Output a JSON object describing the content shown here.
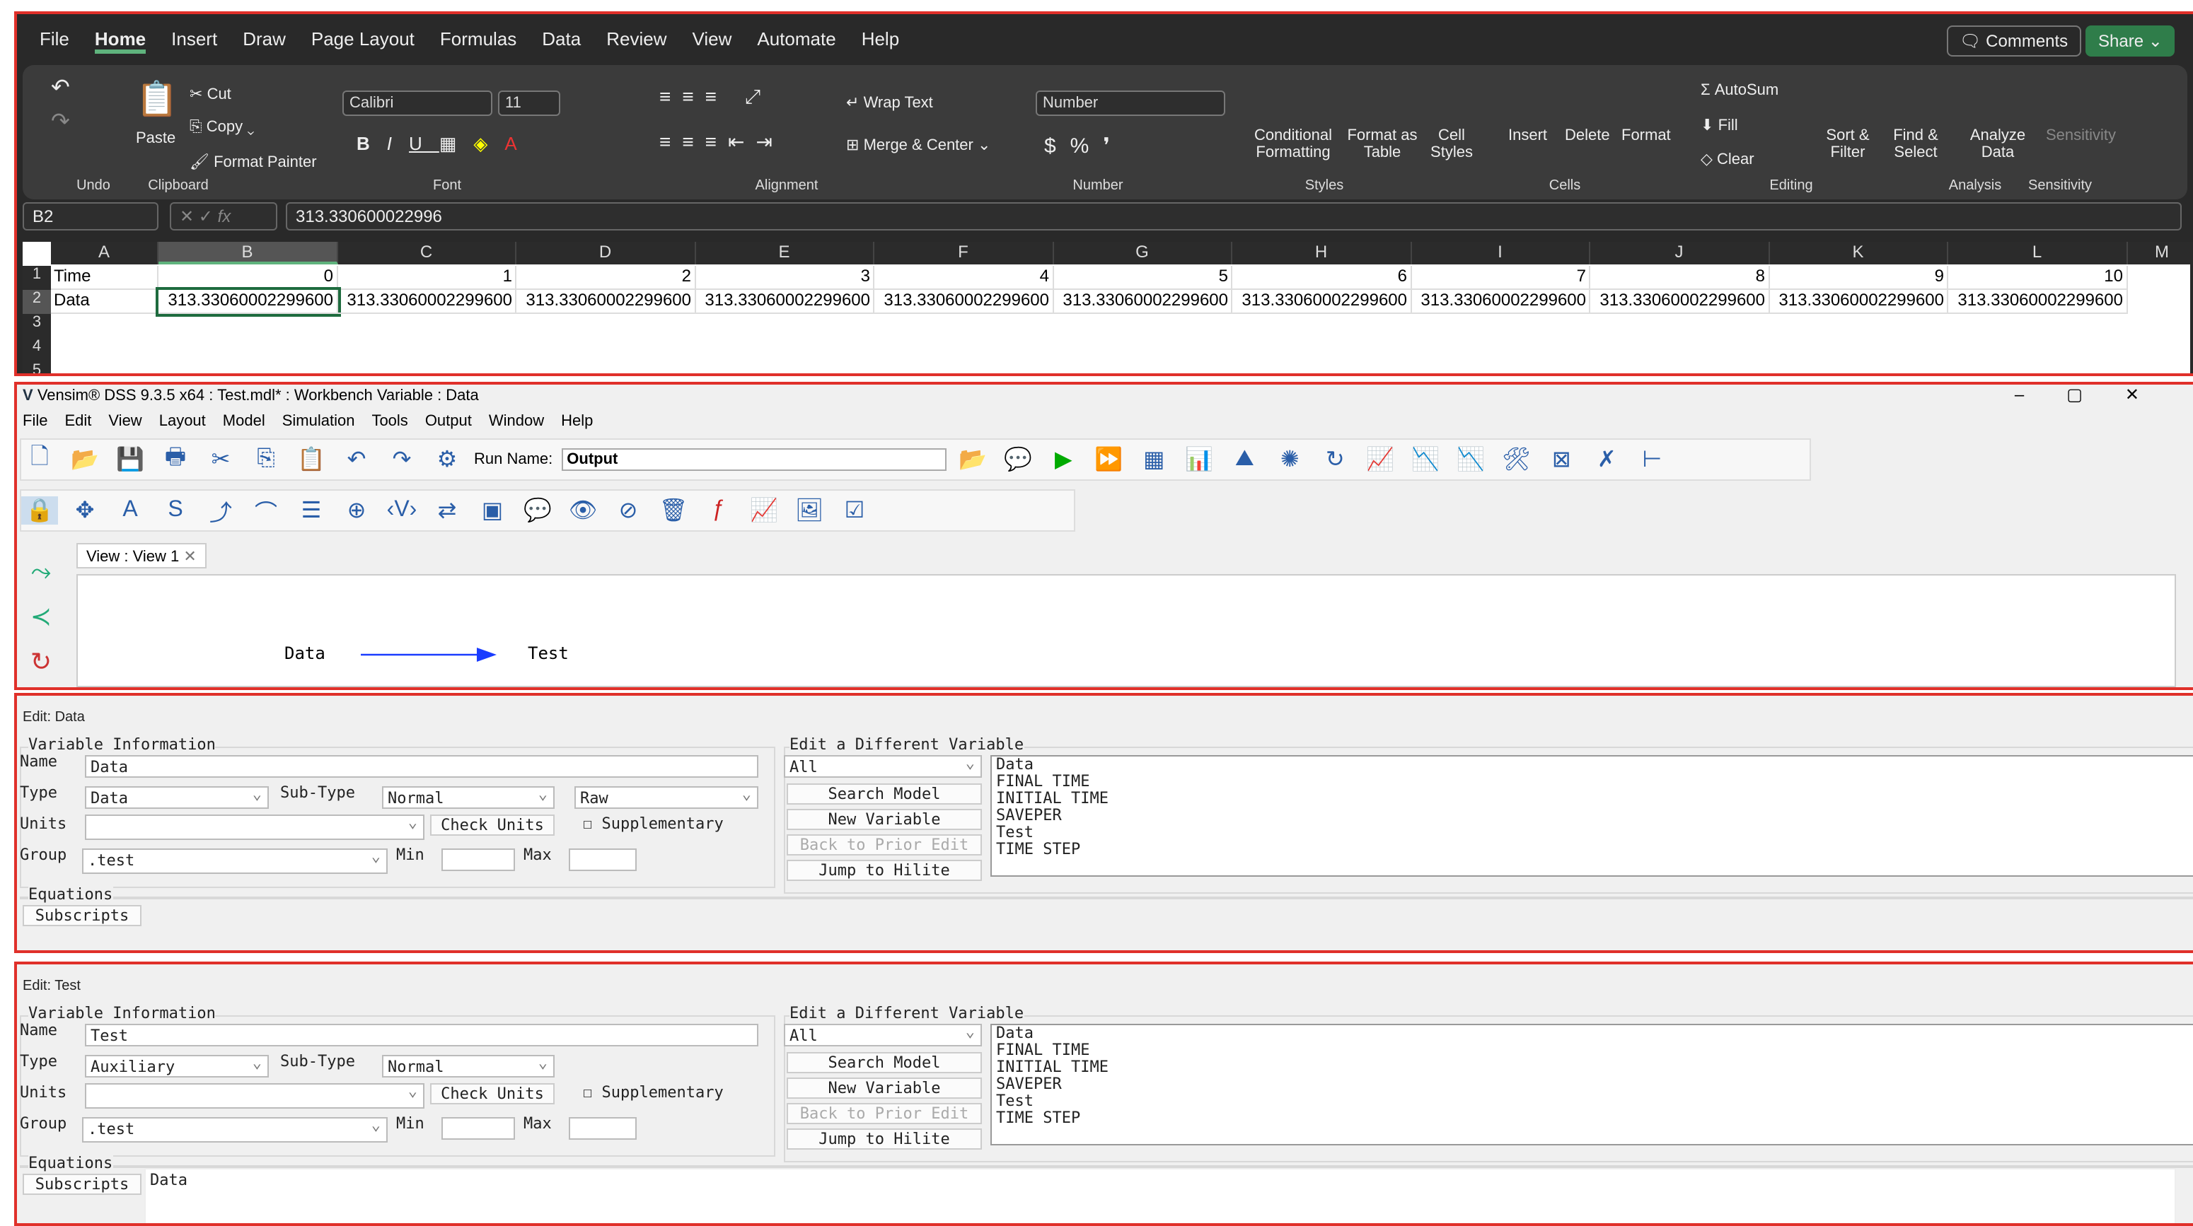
{
  "excel": {
    "tabs": [
      "File",
      "Home",
      "Insert",
      "Draw",
      "Page Layout",
      "Formulas",
      "Data",
      "Review",
      "View",
      "Automate",
      "Help"
    ],
    "active_tab": "Home",
    "comments": "Comments",
    "share": "Share",
    "clipboard": {
      "paste": "Paste",
      "cut": "Cut",
      "copy": "Copy",
      "format_painter": "Format Painter"
    },
    "font": {
      "name": "Calibri",
      "size": "11"
    },
    "alignment": {
      "wrap": "Wrap Text",
      "merge": "Merge & Center"
    },
    "number_format": "Number",
    "styles": [
      "Conditional Formatting",
      "Format as Table",
      "Cell Styles"
    ],
    "cells_btns": [
      "Insert",
      "Delete",
      "Format"
    ],
    "editing": {
      "autosum": "AutoSum",
      "fill": "Fill",
      "clear": "Clear",
      "sort": "Sort & Filter",
      "find": "Find & Select"
    },
    "analyze": "Analyze Data",
    "sensitivity": "Sensitivity",
    "groups": [
      "Undo",
      "Clipboard",
      "Font",
      "Alignment",
      "Number",
      "Styles",
      "Cells",
      "Editing",
      "Analysis",
      "Sensitivity"
    ],
    "name_box": "B2",
    "formula": "313.330600022996",
    "columns": [
      "A",
      "B",
      "C",
      "D",
      "E",
      "F",
      "G",
      "H",
      "I",
      "J",
      "K",
      "L",
      "M"
    ],
    "rows": [
      "1",
      "2",
      "3",
      "4",
      "5"
    ],
    "row1": [
      "Time",
      "0",
      "1",
      "2",
      "3",
      "4",
      "5",
      "6",
      "7",
      "8",
      "9",
      "10"
    ],
    "row2": [
      "Data",
      "313.33060002299600",
      "313.33060002299600",
      "313.33060002299600",
      "313.33060002299600",
      "313.33060002299600",
      "313.33060002299600",
      "313.33060002299600",
      "313.33060002299600",
      "313.33060002299600",
      "313.33060002299600",
      "313.33060002299600"
    ]
  },
  "vensim": {
    "title": "Vensim® DSS 9.3.5 x64 : Test.mdl* : Workbench Variable : Data",
    "menu": [
      "File",
      "Edit",
      "View",
      "Layout",
      "Model",
      "Simulation",
      "Tools",
      "Output",
      "Window",
      "Help"
    ],
    "run_name_label": "Run Name:",
    "run_name": "Output",
    "view_tab": "View : View 1",
    "diagram": {
      "from": "Data",
      "to": "Test"
    }
  },
  "edits": [
    {
      "title": "Edit: Data",
      "section": "Variable Information",
      "name_label": "Name",
      "name": "Data",
      "type_label": "Type",
      "type": "Data",
      "subtype_label": "Sub-Type",
      "subtype": "Normal",
      "extra": "Raw",
      "units_label": "Units",
      "units": "",
      "check_units": "Check Units",
      "supplementary": "Supplementary",
      "group_label": "Group",
      "group": ".test",
      "min_label": "Min",
      "max_label": "Max",
      "equations": "Equations",
      "subscripts": "Subscripts",
      "equation": "",
      "other": {
        "title": "Edit a Different Variable",
        "filter": "All",
        "search": "Search Model",
        "new": "New Variable",
        "back": "Back to Prior Edit",
        "jump": "Jump to Hilite",
        "list": [
          "Data",
          "FINAL TIME",
          "INITIAL TIME",
          "SAVEPER",
          "Test",
          "TIME STEP"
        ]
      }
    },
    {
      "title": "Edit: Test",
      "section": "Variable Information",
      "name_label": "Name",
      "name": "Test",
      "type_label": "Type",
      "type": "Auxiliary",
      "subtype_label": "Sub-Type",
      "subtype": "Normal",
      "units_label": "Units",
      "units": "",
      "check_units": "Check Units",
      "supplementary": "Supplementary",
      "group_label": "Group",
      "group": ".test",
      "min_label": "Min",
      "max_label": "Max",
      "equations": "Equations",
      "subscripts": "Subscripts",
      "equation": "Data",
      "other": {
        "title": "Edit a Different Variable",
        "filter": "All",
        "search": "Search Model",
        "new": "New Variable",
        "back": "Back to Prior Edit",
        "jump": "Jump to Hilite",
        "list": [
          "Data",
          "FINAL TIME",
          "INITIAL TIME",
          "SAVEPER",
          "Test",
          "TIME STEP"
        ]
      }
    }
  ],
  "colors": {
    "highlight": "#e0302a",
    "excel_accent": "#5fb37d",
    "arrow": "#1a3cff"
  }
}
